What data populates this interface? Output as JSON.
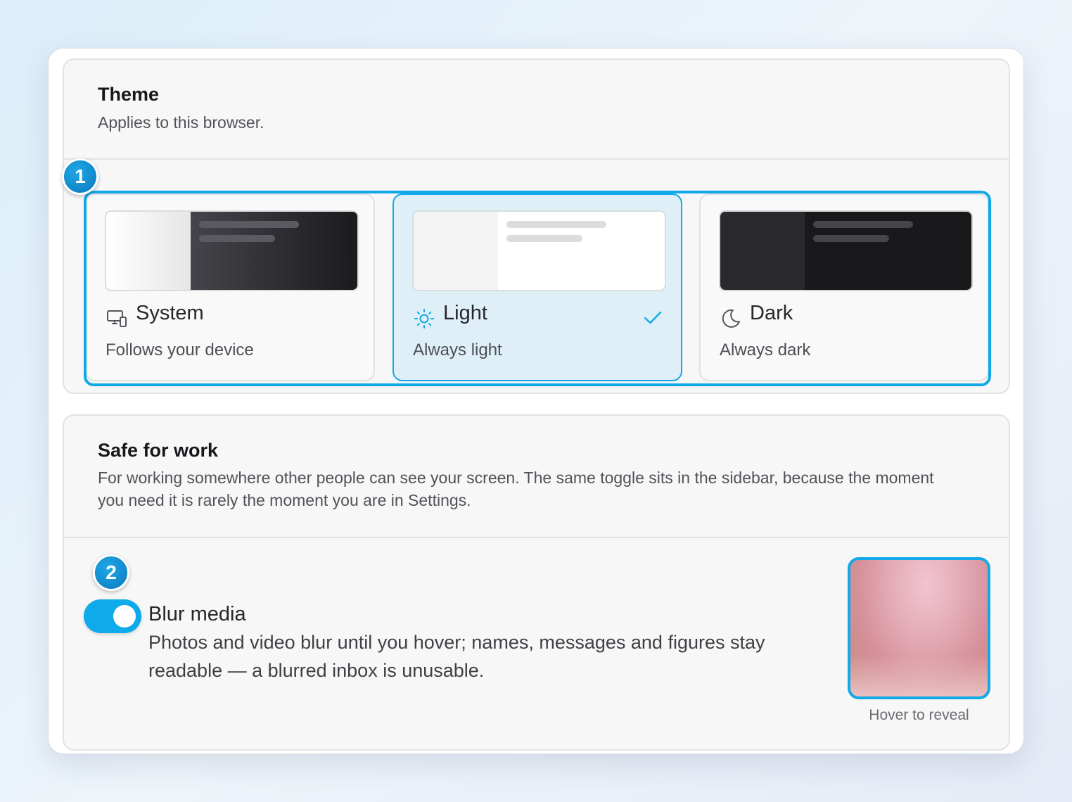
{
  "theme": {
    "title": "Theme",
    "description": "Applies to this browser.",
    "options": [
      {
        "label": "System",
        "description": "Follows your device",
        "icon": "monitor-phone-icon",
        "selected": false
      },
      {
        "label": "Light",
        "description": "Always light",
        "icon": "sun-icon",
        "selected": true
      },
      {
        "label": "Dark",
        "description": "Always dark",
        "icon": "moon-icon",
        "selected": false
      }
    ],
    "badge": "1"
  },
  "safe_for_work": {
    "title": "Safe for work",
    "description": "For working somewhere other people can see your screen. The same toggle sits in the sidebar, because the moment you need it is rarely the moment you are in Settings.",
    "badge": "2",
    "blur_media": {
      "label": "Blur media",
      "description": "Photos and video blur until you hover; names, messages and figures stay readable — a blurred inbox is unusable.",
      "enabled": true
    },
    "preview_caption": "Hover to reveal"
  },
  "colors": {
    "accent": "#0EAAEA",
    "selected_bg": "#DFEFF7",
    "badge": "#0A78BD"
  }
}
